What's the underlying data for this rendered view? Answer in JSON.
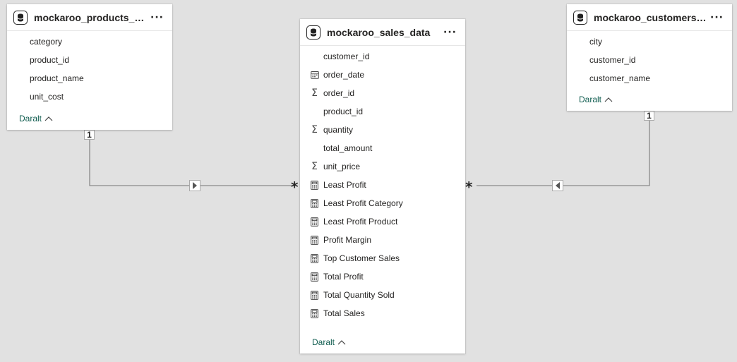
{
  "tables": {
    "products": {
      "title": "mockaroo_products_data",
      "fields": [
        "category",
        "product_id",
        "product_name",
        "unit_cost"
      ],
      "collapse_label": "Daralt"
    },
    "sales": {
      "title": "mockaroo_sales_data",
      "fields": [
        {
          "name": "customer_id",
          "icon": "none"
        },
        {
          "name": "order_date",
          "icon": "calendar-icon"
        },
        {
          "name": "order_id",
          "icon": "sigma-icon"
        },
        {
          "name": "product_id",
          "icon": "none"
        },
        {
          "name": "quantity",
          "icon": "sigma-icon"
        },
        {
          "name": "total_amount",
          "icon": "none"
        },
        {
          "name": "unit_price",
          "icon": "sigma-icon"
        },
        {
          "name": "Least Profit",
          "icon": "calculator-icon"
        },
        {
          "name": "Least Profit Category",
          "icon": "calculator-icon"
        },
        {
          "name": "Least Profit Product",
          "icon": "calculator-icon"
        },
        {
          "name": "Profit Margin",
          "icon": "calculator-icon"
        },
        {
          "name": "Top Customer Sales",
          "icon": "calculator-icon"
        },
        {
          "name": "Total Profit",
          "icon": "calculator-icon"
        },
        {
          "name": "Total Quantity Sold",
          "icon": "calculator-icon"
        },
        {
          "name": "Total Sales",
          "icon": "calculator-icon"
        }
      ],
      "collapse_label": "Daralt"
    },
    "customers": {
      "title": "mockaroo_customers_d...",
      "fields": [
        "city",
        "customer_id",
        "customer_name"
      ],
      "collapse_label": "Daralt"
    }
  },
  "relationships": {
    "products_to_sales": {
      "one": "1",
      "many": "*"
    },
    "customers_to_sales": {
      "one": "1",
      "many": "*"
    }
  },
  "colors": {
    "canvas": "#e1e1e1",
    "collapse_link": "#0f5c4f",
    "line": "#8a8a8a"
  }
}
